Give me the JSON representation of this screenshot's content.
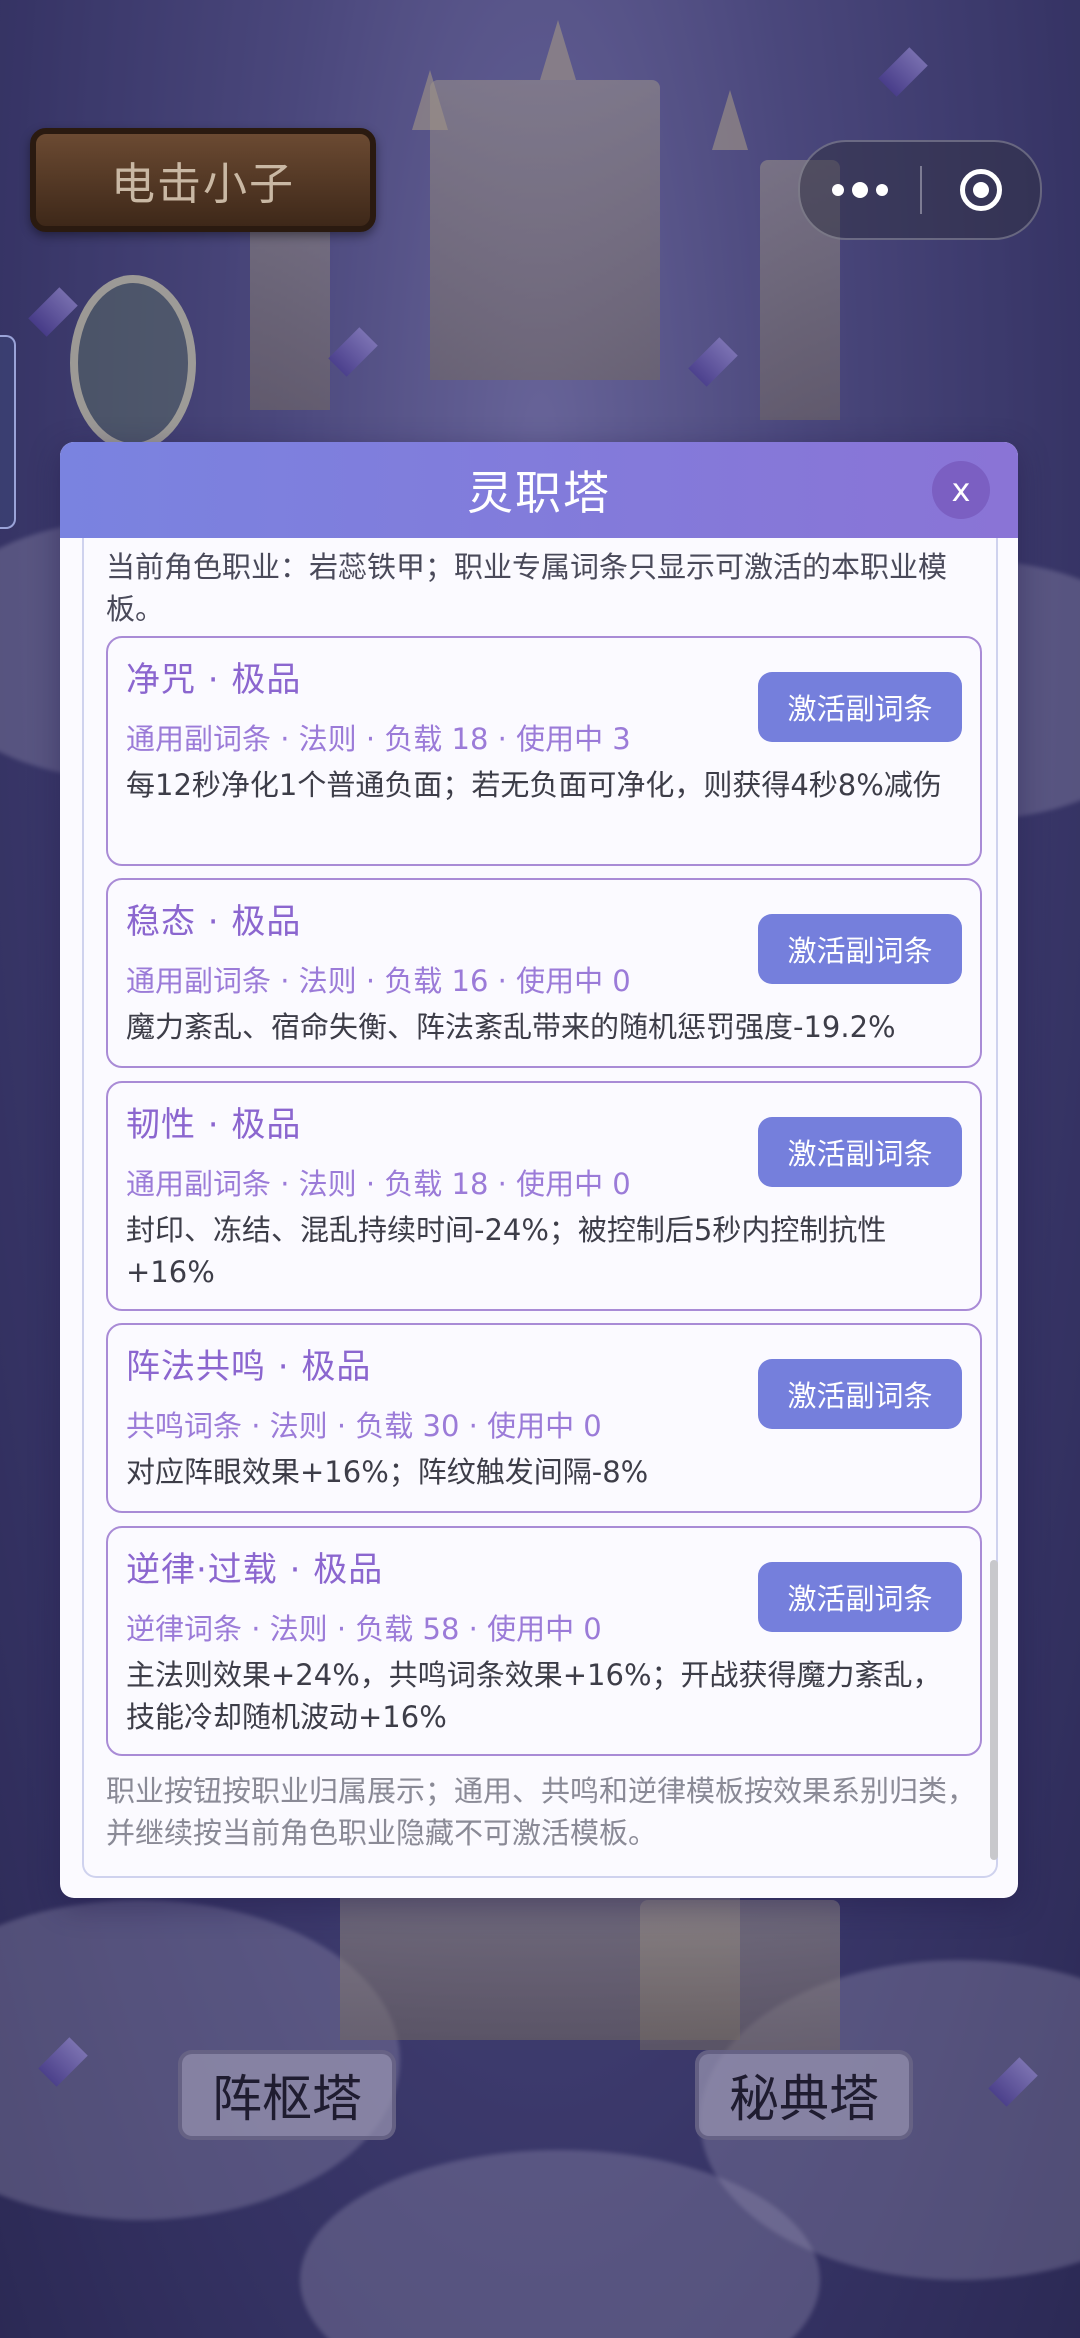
{
  "player": {
    "name": "电击小子"
  },
  "capsule": {
    "more_icon": "ellipsis-icon",
    "close_icon": "target-circle-icon"
  },
  "modal": {
    "title": "灵职塔",
    "close_label": "x",
    "intro": "当前角色职业：岩蕊铁甲；职业专属词条只显示可激活的本职业模板。",
    "cards": [
      {
        "title": "净咒 · 极品",
        "meta": "通用副词条 · 法则 · 负载 18 · 使用中 3",
        "desc": "每12秒净化1个普通负面；若无负面可净化，则获得4秒8%减伤",
        "button": "激活副词条"
      },
      {
        "title": "稳态 · 极品",
        "meta": "通用副词条 · 法则 · 负载 16 · 使用中 0",
        "desc": "魔力紊乱、宿命失衡、阵法紊乱带来的随机惩罚强度-19.2%",
        "button": "激活副词条"
      },
      {
        "title": "韧性 · 极品",
        "meta": "通用副词条 · 法则 · 负载 18 · 使用中 0",
        "desc": "封印、冻结、混乱持续时间-24%；被控制后5秒内控制抗性+16%",
        "button": "激活副词条"
      },
      {
        "title": "阵法共鸣 · 极品",
        "meta": "共鸣词条 · 法则 · 负载 30 · 使用中 0",
        "desc": "对应阵眼效果+16%；阵纹触发间隔-8%",
        "button": "激活副词条"
      },
      {
        "title": "逆律·过载 · 极品",
        "meta": "逆律词条 · 法则 · 负载 58 · 使用中 0",
        "desc": "主法则效果+24%，共鸣词条效果+16%；开战获得魔力紊乱，技能冷却随机波动+16%",
        "button": "激活副词条"
      }
    ],
    "footer_note": "职业按钮按职业归属展示；通用、共鸣和逆律模板按效果系别归类，并继续按当前角色职业隐藏不可激活模板。"
  },
  "bottom_buttons": {
    "left": "阵枢塔",
    "right": "秘典塔"
  }
}
